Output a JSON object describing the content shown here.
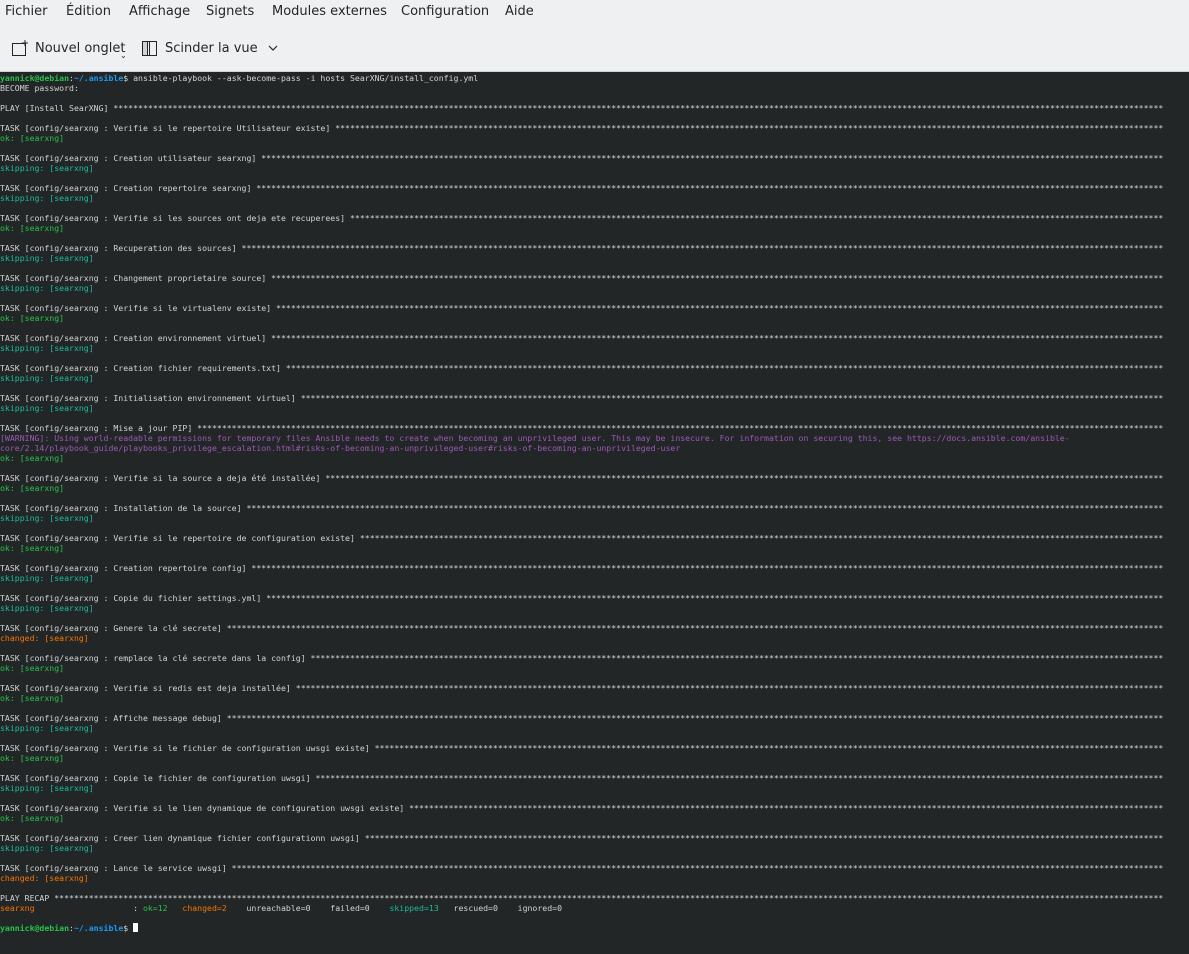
{
  "menubar": {
    "items": [
      "Fichier",
      "Édition",
      "Affichage",
      "Signets",
      "Modules externes",
      "Configuration",
      "Aide"
    ]
  },
  "toolbar": {
    "new_tab_label": "Nouvel onglet",
    "split_view_label": "Scinder la vue",
    "icons": {
      "new_tab": "new-tab-icon",
      "split": "split-view-icon",
      "dropdown": "chevron-down-icon"
    }
  },
  "colors": {
    "background": "#232627",
    "default": "#d3d4d3",
    "ok": "#27c24c",
    "skipping": "#1abc9c",
    "changed": "#f67400",
    "warning": "#9b59b6",
    "user": "#27c24c",
    "path": "#1d99f3"
  },
  "terminal": {
    "command_line": {
      "user": "yannick@debian",
      "sep": ":",
      "path": "~/.ansible",
      "prompt": "$",
      "command": " ansible-playbook --ask-become-pass -i hosts SearXNG/install_config.yml"
    },
    "become_prompt": "BECOME password:",
    "play_header": "PLAY [Install SearXNG]",
    "tasks": [
      {
        "name": "TASK [config/searxng : Verifie si le repertoire Utilisateur existe]",
        "status": "ok: [searxng]",
        "kind": "ok"
      },
      {
        "name": "TASK [config/searxng : Creation utilisateur searxng]",
        "status": "skipping: [searxng]",
        "kind": "skip"
      },
      {
        "name": "TASK [config/searxng : Creation repertoire searxng]",
        "status": "skipping: [searxng]",
        "kind": "skip"
      },
      {
        "name": "TASK [config/searxng : Verifie si les sources ont deja ete recuperees]",
        "status": "ok: [searxng]",
        "kind": "ok"
      },
      {
        "name": "TASK [config/searxng : Recuperation des sources]",
        "status": "skipping: [searxng]",
        "kind": "skip"
      },
      {
        "name": "TASK [config/searxng : Changement proprietaire source]",
        "status": "skipping: [searxng]",
        "kind": "skip"
      },
      {
        "name": "TASK [config/searxng : Verifie si le virtualenv existe]",
        "status": "ok: [searxng]",
        "kind": "ok"
      },
      {
        "name": "TASK [config/searxng : Creation environnement virtuel]",
        "status": "skipping: [searxng]",
        "kind": "skip"
      },
      {
        "name": "TASK [config/searxng : Creation fichier requirements.txt]",
        "status": "skipping: [searxng]",
        "kind": "skip"
      },
      {
        "name": "TASK [config/searxng : Initialisation environnement virtuel]",
        "status": "skipping: [searxng]",
        "kind": "skip"
      },
      {
        "name": "TASK [config/searxng : Mise a jour PIP]",
        "status": "ok: [searxng]",
        "kind": "ok",
        "warning": [
          "[WARNING]: Using world-readable permissions for temporary files Ansible needs to create when becoming an unprivileged user. This may be insecure. For information on securing this, see https://docs.ansible.com/ansible-",
          "core/2.14/playbook_guide/playbooks_privilege_escalation.html#risks-of-becoming-an-unprivileged-user#risks-of-becoming-an-unprivileged-user"
        ]
      },
      {
        "name": "TASK [config/searxng : Verifie si la source a deja été installée]",
        "status": "ok: [searxng]",
        "kind": "ok"
      },
      {
        "name": "TASK [config/searxng : Installation de la source]",
        "status": "skipping: [searxng]",
        "kind": "skip"
      },
      {
        "name": "TASK [config/searxng : Verifie si le repertoire de configuration existe]",
        "status": "ok: [searxng]",
        "kind": "ok"
      },
      {
        "name": "TASK [config/searxng : Creation repertoire config]",
        "status": "skipping: [searxng]",
        "kind": "skip"
      },
      {
        "name": "TASK [config/searxng : Copie du fichier settings.yml]",
        "status": "skipping: [searxng]",
        "kind": "skip"
      },
      {
        "name": "TASK [config/searxng : Genere la clé secrete]",
        "status": "changed: [searxng]",
        "kind": "changed"
      },
      {
        "name": "TASK [config/searxng : remplace la clé secrete dans la config]",
        "status": "ok: [searxng]",
        "kind": "ok"
      },
      {
        "name": "TASK [config/searxng : Verifie si redis est deja installée]",
        "status": "ok: [searxng]",
        "kind": "ok"
      },
      {
        "name": "TASK [config/searxng : Affiche message debug]",
        "status": "skipping: [searxng]",
        "kind": "skip"
      },
      {
        "name": "TASK [config/searxng : Verifie si le fichier de configuration uwsgi existe]",
        "status": "ok: [searxng]",
        "kind": "ok"
      },
      {
        "name": "TASK [config/searxng : Copie le fichier de configuration uwsgi]",
        "status": "skipping: [searxng]",
        "kind": "skip"
      },
      {
        "name": "TASK [config/searxng : Verifie si le lien dynamique de configuration uwsgi existe]",
        "status": "ok: [searxng]",
        "kind": "ok"
      },
      {
        "name": "TASK [config/searxng : Creer lien dynamique fichier configurationn uwsgi]",
        "status": "skipping: [searxng]",
        "kind": "skip"
      },
      {
        "name": "TASK [config/searxng : Lance le service uwsgi]",
        "status": "changed: [searxng]",
        "kind": "changed"
      }
    ],
    "recap": {
      "header": "PLAY RECAP",
      "host": "searxng",
      "colon": ": ",
      "ok": "ok=12",
      "changed": "changed=2",
      "unreachable": "unreachable=0",
      "failed": "failed=0",
      "skipped": "skipped=13",
      "rescued": "rescued=0",
      "ignored": "ignored=0"
    },
    "final_prompt": {
      "user": "yannick@debian",
      "sep": ":",
      "path": "~/.ansible",
      "prompt": "$"
    }
  }
}
